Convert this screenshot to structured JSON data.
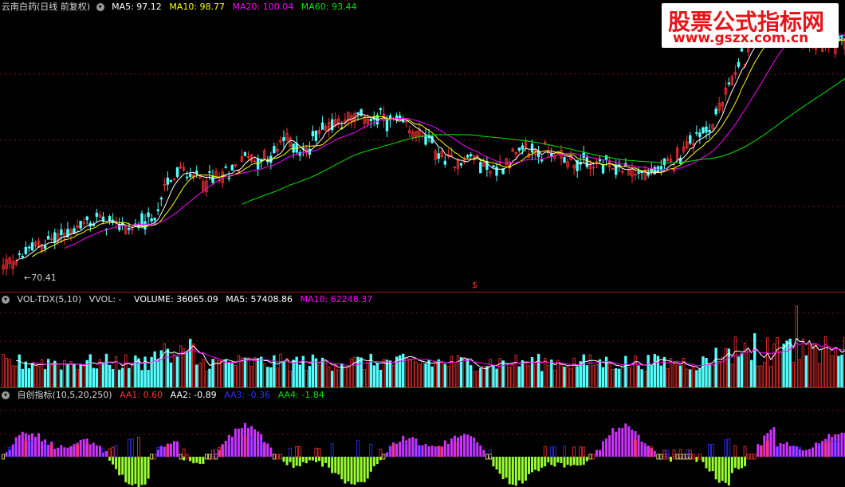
{
  "price_panel": {
    "title": "云南白药(日线 前复权)",
    "ma5": "MA5: 97.12",
    "ma10": "MA10: 98.77",
    "ma20": "MA20: 100.04",
    "ma60": "MA60: 93.44",
    "low_label": "70.41",
    "signal_mark": "$"
  },
  "volume_panel": {
    "title": "VOL-TDX(5,10)",
    "vvol": "VVOL: -",
    "volume": "VOLUME: 36065.09",
    "ma5": "MA5: 57408.86",
    "ma10": "MA10: 62248.37"
  },
  "indicator_panel": {
    "title": "自创指标(10,5,20,250)",
    "aa1": "AA1: 0.60",
    "aa2": "AA2: -0.89",
    "aa3": "AA3: -0.36",
    "aa4": "AA4: -1.84"
  },
  "watermark": {
    "line1": "股票公式指标网",
    "line2": "www.gszx.com.cn"
  },
  "colors": {
    "up": "#ff3232",
    "down": "#54ffff",
    "ma5": "#ffffff",
    "ma10": "#ffff00",
    "ma20": "#ff00ff",
    "ma60": "#00e600",
    "aa1": "#ff3232",
    "aa2": "#ffffff",
    "aa3": "#3030ff",
    "aa4": "#00e600",
    "bar_magenta": "#cc33ff",
    "bar_green": "#99ff33"
  },
  "icons": [
    "circle-chevron-icon"
  ]
}
